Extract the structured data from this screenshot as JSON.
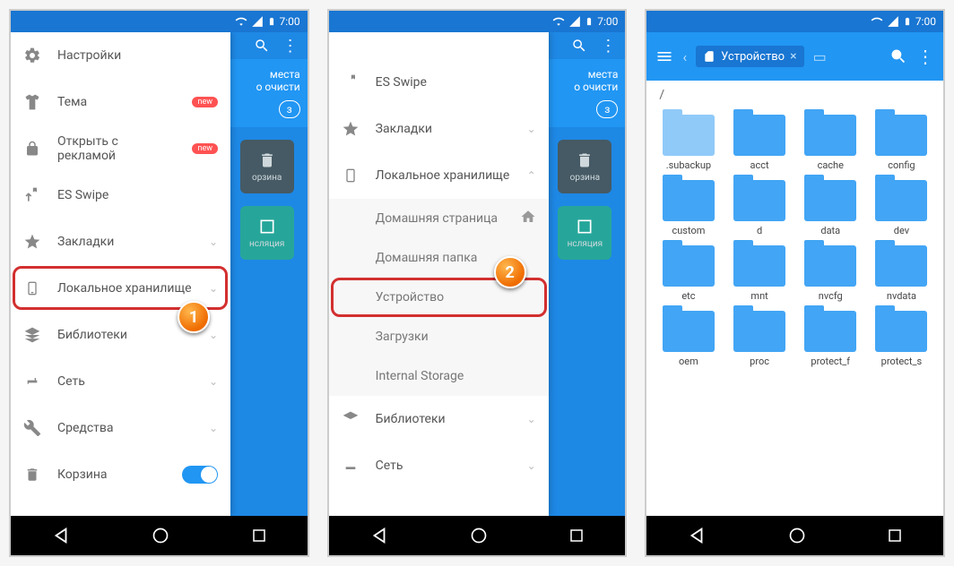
{
  "status": {
    "time": "7:00"
  },
  "screen1": {
    "items": [
      {
        "icon": "gear",
        "label": "Настройки"
      },
      {
        "icon": "shirt",
        "label": "Тема",
        "badge": "new"
      },
      {
        "icon": "lock",
        "label": "Открыть с рекламой",
        "badge": "new"
      },
      {
        "icon": "swipe",
        "label": "ES Swipe"
      },
      {
        "icon": "star",
        "label": "Закладки",
        "chev": true
      },
      {
        "icon": "phone",
        "label": "Локальное хранилище",
        "chev": true,
        "highlighted": true
      },
      {
        "icon": "stack",
        "label": "Библиотеки",
        "chev": true
      },
      {
        "icon": "router",
        "label": "Сеть",
        "chev": true
      },
      {
        "icon": "wrench",
        "label": "Средства",
        "chev": true
      },
      {
        "icon": "trash",
        "label": "Корзина",
        "toggle": true
      }
    ],
    "backdrop": {
      "line1": "места",
      "line2": "о очисти",
      "tile1": "орзина",
      "tile2": "нсляция"
    },
    "callout": "1"
  },
  "screen2": {
    "items": [
      {
        "icon": "swipe",
        "label": "ES Swipe"
      },
      {
        "icon": "star",
        "label": "Закладки",
        "chev": true
      },
      {
        "icon": "phone",
        "label": "Локальное хранилище",
        "chev": true,
        "expanded": true
      }
    ],
    "subs": [
      {
        "label": "Домашняя страница",
        "icon": "home"
      },
      {
        "label": "Домашняя папка"
      },
      {
        "label": "Устройство",
        "highlighted": true
      },
      {
        "label": "Загрузки"
      },
      {
        "label": "Internal Storage"
      }
    ],
    "items2": [
      {
        "icon": "stack",
        "label": "Библиотеки",
        "chev": true
      },
      {
        "icon": "router",
        "label": "Сеть",
        "chev": true
      }
    ],
    "backdrop": {
      "line1": "места",
      "line2": "о очисти",
      "tile1": "орзина",
      "tile2": "нсляция"
    },
    "callout": "2"
  },
  "screen3": {
    "chip": "Устройство",
    "crumb": "/",
    "folders": [
      ".subackup",
      "acct",
      "cache",
      "config",
      "custom",
      "d",
      "data",
      "dev",
      "etc",
      "mnt",
      "nvcfg",
      "nvdata",
      "oem",
      "proc",
      "protect_f",
      "protect_s"
    ]
  },
  "nav": {
    "back": "◁",
    "home": "○",
    "recent": "□"
  }
}
